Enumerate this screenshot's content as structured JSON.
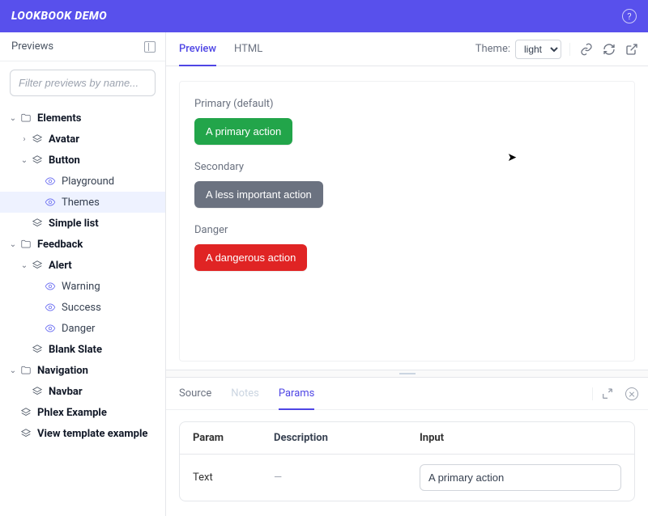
{
  "header": {
    "title": "LOOKBOOK DEMO"
  },
  "sidebar": {
    "title": "Previews",
    "search_placeholder": "Filter previews by name...",
    "tree": {
      "elements": {
        "label": "Elements",
        "avatar": "Avatar",
        "button": {
          "label": "Button",
          "playground": "Playground",
          "themes": "Themes"
        },
        "simple_list": "Simple list"
      },
      "feedback": {
        "label": "Feedback",
        "alert": {
          "label": "Alert",
          "warning": "Warning",
          "success": "Success",
          "danger": "Danger"
        },
        "blank_slate": "Blank Slate"
      },
      "navigation": {
        "label": "Navigation",
        "navbar": "Navbar"
      },
      "phlex": "Phlex Example",
      "vte": "View template example"
    }
  },
  "topbar": {
    "tabs": {
      "preview": "Preview",
      "html": "HTML"
    },
    "theme_label": "Theme:",
    "theme_value": "light"
  },
  "preview": {
    "groups": [
      {
        "label": "Primary (default)",
        "button": "A primary action",
        "variant": "primary"
      },
      {
        "label": "Secondary",
        "button": "A less important action",
        "variant": "secondary"
      },
      {
        "label": "Danger",
        "button": "A dangerous action",
        "variant": "danger"
      }
    ]
  },
  "bottom": {
    "tabs": {
      "source": "Source",
      "notes": "Notes",
      "params": "Params"
    },
    "table": {
      "headers": {
        "param": "Param",
        "description": "Description",
        "input": "Input"
      },
      "row": {
        "param": "Text",
        "description": "—",
        "input_value": "A primary action"
      }
    }
  }
}
